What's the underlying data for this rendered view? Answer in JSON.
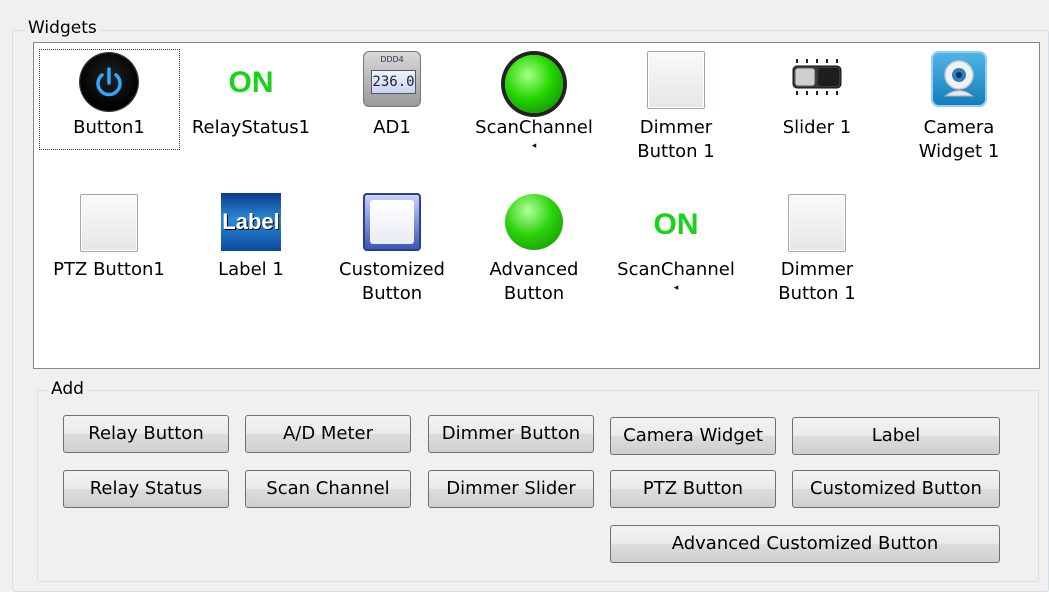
{
  "widgets_group": {
    "title": "Widgets",
    "items": [
      {
        "label": "Button1",
        "icon": "power-icon"
      },
      {
        "label": "RelayStatus1",
        "icon": "on-status-icon",
        "icon_text": "ON"
      },
      {
        "label": "AD1",
        "icon": "ad-meter-icon",
        "meter_value": "236.0",
        "meter_top": "DDD4"
      },
      {
        "label": "ScanChannel",
        "icon": "green-led-icon"
      },
      {
        "label": "Dimmer Button 1",
        "label_lines": [
          "Dimmer",
          "Button 1"
        ],
        "icon": "square-button-icon"
      },
      {
        "label": "Slider 1",
        "icon": "slider-icon"
      },
      {
        "label": "Camera Widget 1",
        "label_lines": [
          "Camera",
          "Widget 1"
        ],
        "icon": "webcam-icon"
      },
      {
        "label": "PTZ Button1",
        "icon": "square-button-icon"
      },
      {
        "label": "Label 1",
        "icon": "label-image-icon",
        "icon_text": "Label"
      },
      {
        "label": "Customized Button",
        "label_lines": [
          "Customized",
          "Button"
        ],
        "icon": "customized-button-icon"
      },
      {
        "label": "Advanced Button",
        "label_lines": [
          "Advanced",
          "Button"
        ],
        "icon": "green-ball-icon"
      },
      {
        "label": "ScanChannel",
        "icon": "on-status-icon",
        "icon_text": "ON"
      },
      {
        "label": "Dimmer Button 1",
        "label_lines": [
          "Dimmer",
          "Button 1"
        ],
        "icon": "square-button-icon"
      }
    ]
  },
  "add_group": {
    "title": "Add",
    "buttons": [
      "Relay Button",
      "A/D Meter",
      "Dimmer Button",
      "Camera Widget",
      "Label",
      "Relay Status",
      "Scan Channel",
      "Dimmer Slider",
      "PTZ Button",
      "Customized Button",
      "Advanced Customized Button"
    ]
  },
  "colors": {
    "on_green": "#18d318",
    "selection_focus": "#333333"
  }
}
